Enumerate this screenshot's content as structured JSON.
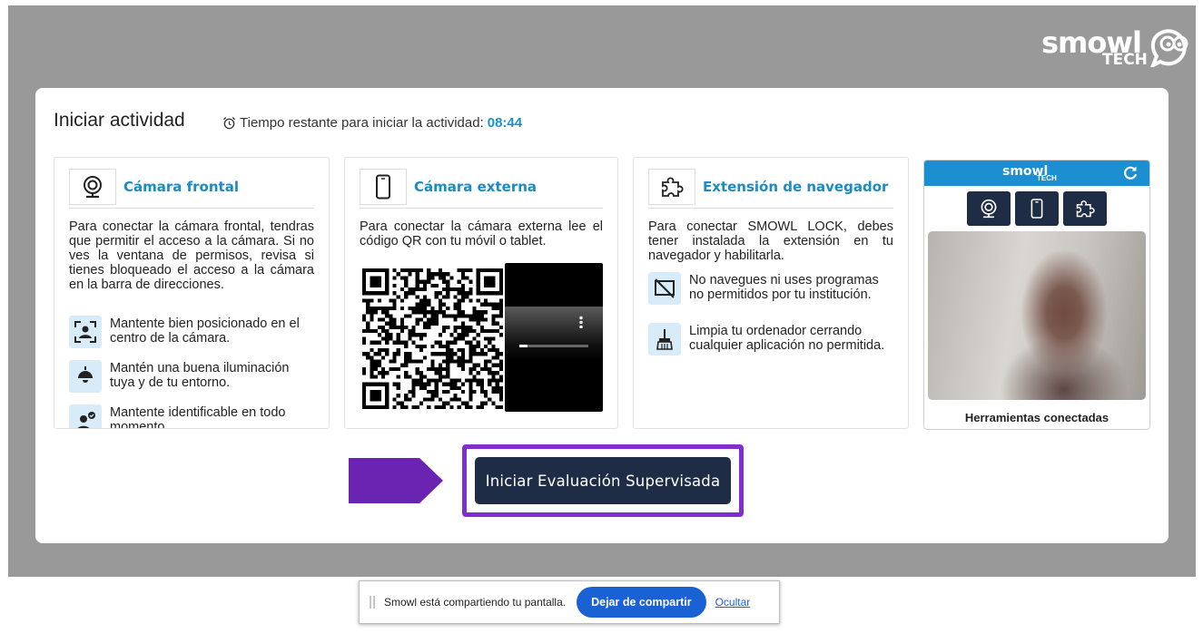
{
  "header": {
    "logo_word": "smowl",
    "logo_sub": "TECH"
  },
  "activity": {
    "title": "Iniciar actividad",
    "timer_label": "Tiempo restante para iniciar la actividad:",
    "timer_value": "08:44"
  },
  "panels": [
    {
      "title": "Cámara frontal",
      "icon": "webcam-icon",
      "description": "Para conectar la cámara frontal, tendras que permitir el acceso a la cámara. Si no ves la ventana de permisos, revisa si tienes bloqueado el acceso a la cámara en la barra de direcciones.",
      "tips": [
        "Mantente bien posicionado en el centro de la cámara.",
        "Mantén una buena iluminación tuya y de tu entorno.",
        "Mantente identificable en todo momento."
      ]
    },
    {
      "title": "Cámara externa",
      "icon": "smartphone-icon",
      "description": "Para conectar la cámara externa lee el código QR con tu móvil o tablet."
    },
    {
      "title": "Extensión de navegador",
      "icon": "puzzle-icon",
      "description": "Para conectar SMOWL LOCK, debes tener instalada la extensión en tu navegador y habilitarla.",
      "tips": [
        "No navegues ni uses programas no permitidos por tu institución.",
        "Limpia tu ordenador cerrando cualquier aplicación no permitida."
      ]
    }
  ],
  "widget": {
    "logo_word": "smowl",
    "logo_sub": "TECH",
    "caption": "Herramientas conectadas",
    "accent": "#1b8fcf"
  },
  "start_button": {
    "label": "Iniciar Evaluación Supervisada",
    "highlight": "#7d2fd0"
  },
  "sharing": {
    "message": "Smowl está compartiendo tu pantalla.",
    "stop_label": "Dejar de compartir",
    "hide_label": "Ocultar"
  }
}
